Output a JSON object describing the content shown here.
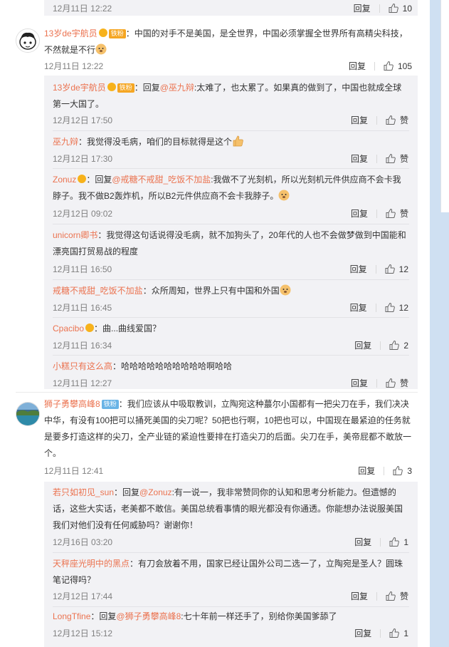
{
  "top_partial": {
    "time": "12月11日 12:22",
    "reply": "回复",
    "likes": "10"
  },
  "comments": [
    {
      "user": "13岁de宇航员",
      "badge": "铁粉",
      "text": "：中国的对手不是美国，是全世界，中国必须掌握全世界所有高精尖科技，不然就是不行",
      "time": "12月11日 12:22",
      "reply": "回复",
      "likes": "105",
      "replies": [
        {
          "user": "13岁de宇航员",
          "badge": "铁粉",
          "prefix": "：回复",
          "mention": "@巫九辩",
          "text": ":太难了，也太累了。如果真的做到了，中国也就成全球第一大国了。",
          "time": "12月12日 17:50",
          "reply": "回复",
          "likes": "赞"
        },
        {
          "user": "巫九辩",
          "text": "：我觉得没毛病，咱们的目标就得是这个",
          "time": "12月12日 17:30",
          "reply": "回复",
          "likes": "赞"
        },
        {
          "user": "Zonuz",
          "prefix": "：回复",
          "mention": "@戒糖不戒甜_吃饭不加盐",
          "text": ":我做不了光刻机，所以光刻机元件供应商不会卡我脖子。我不做B2轰炸机，所以B2元件供应商不会卡我脖子。",
          "time": "12月12日 09:02",
          "reply": "回复",
          "likes": "赞"
        },
        {
          "user": "unicorn卿书",
          "text": "：我觉得这句话说得没毛病，就不加狗头了，20年代的人也不会做梦做到中国能和漂亮国打贸易战的程度",
          "time": "12月11日 16:50",
          "reply": "回复",
          "likes": "12"
        },
        {
          "user": "戒糖不戒甜_吃饭不加盐",
          "text": "：众所周知，世界上只有中国和外国",
          "time": "12月11日 16:45",
          "reply": "回复",
          "likes": "12"
        },
        {
          "user": "Cpacibo",
          "text": "：曲...曲线爱国？",
          "time": "12月11日 16:34",
          "reply": "回复",
          "likes": "2"
        },
        {
          "user": "小糕只有这么高",
          "text": "：哈哈哈哈哈哈哈哈哈哈啊哈哈",
          "time": "12月11日 12:27",
          "reply": "回复",
          "likes": "赞"
        }
      ]
    },
    {
      "user": "狮子勇攀高峰8",
      "badge": "铁粉",
      "text": "：我们应该从中吸取教训，立陶宛这种蕞尔小国都有一把尖刀在手，我们决决中华，有没有100把可以捅死美国的尖刀呢？50把也行啊，10把也可以，中国现在最紧迫的任务就是要多打造这样的尖刀，全产业链的紧迫性要排在打造尖刀的后面。尖刀在手，美帝屁都不敢放一个。",
      "time": "12月11日 12:41",
      "reply": "回复",
      "likes": "3",
      "replies": [
        {
          "user": "若只如初见_sun",
          "prefix": "：回复",
          "mention": "@Zonuz",
          "text": ":有一说一，我非常赞同你的认知和思考分析能力。但遗憾的话，这些大实话，老美都不敢信。美国总统看事情的眼光都没有你通透。你能想办法说服美国我们对他们没有任何威胁吗？谢谢你！",
          "time": "12月16日 03:20",
          "reply": "回复",
          "likes": "1"
        },
        {
          "user": "天秤座光明中的黑点",
          "text": "：有刀会放着不用，国家已经让国外公司二选一了，立陶宛是圣人？圆珠笔记得吗？",
          "time": "12月12日 17:44",
          "reply": "回复",
          "likes": "赞"
        },
        {
          "user": "LongTfine",
          "prefix": "：回复",
          "mention": "@狮子勇攀高峰8",
          "text": ":七十年前一样还手了，别给你美国爹舔了",
          "time": "12月12日 15:12",
          "reply": "回复",
          "likes": "1"
        }
      ]
    }
  ]
}
